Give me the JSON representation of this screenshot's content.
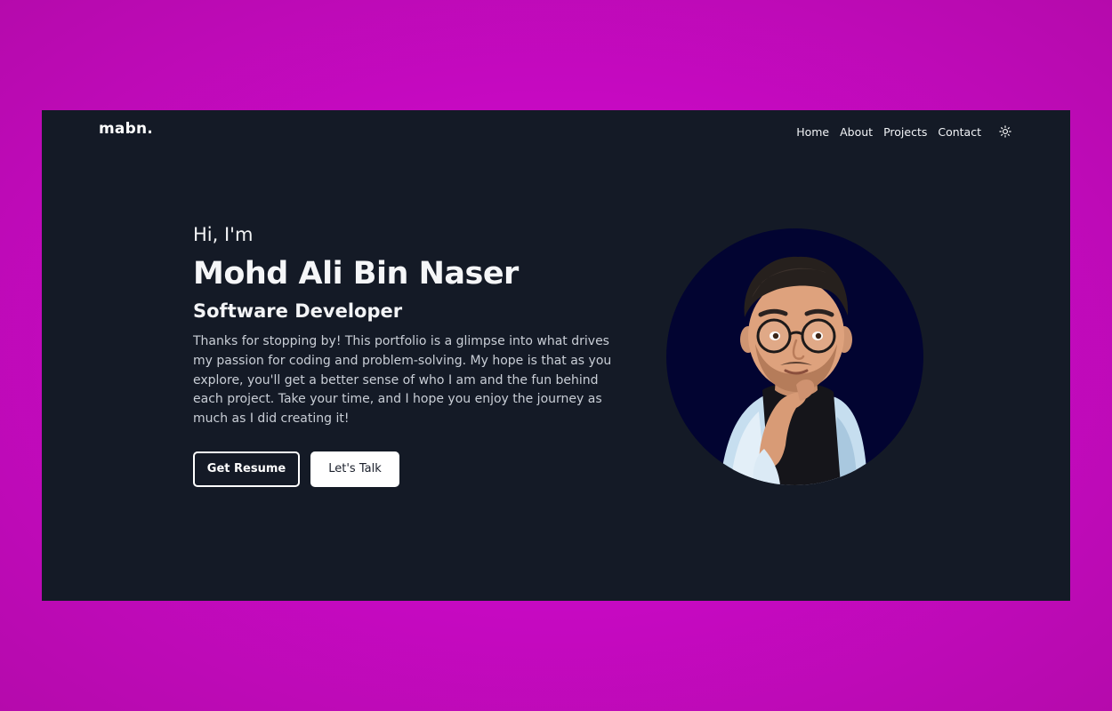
{
  "header": {
    "logo": "mabn.",
    "nav": [
      {
        "label": "Home"
      },
      {
        "label": "About"
      },
      {
        "label": "Projects"
      },
      {
        "label": "Contact"
      }
    ],
    "theme_toggle_icon": "sun-icon"
  },
  "hero": {
    "greeting": "Hi, I'm",
    "name": "Mohd Ali Bin Naser",
    "role": "Software Developer",
    "intro": "Thanks for stopping by! This portfolio is a glimpse into what drives my passion for coding and problem-solving. My hope is that as you explore, you'll get a better sense of who I am and the fun behind each project. Take your time, and I hope you enjoy the journey as much as I did creating it!",
    "primary_button": "Get Resume",
    "secondary_button": "Let's Talk"
  },
  "avatar": {
    "icon": "memoji-avatar",
    "background": "#020431"
  },
  "colors": {
    "page_background": "#c809c4",
    "window_background": "#141a26",
    "text": "#f3f4f6"
  }
}
